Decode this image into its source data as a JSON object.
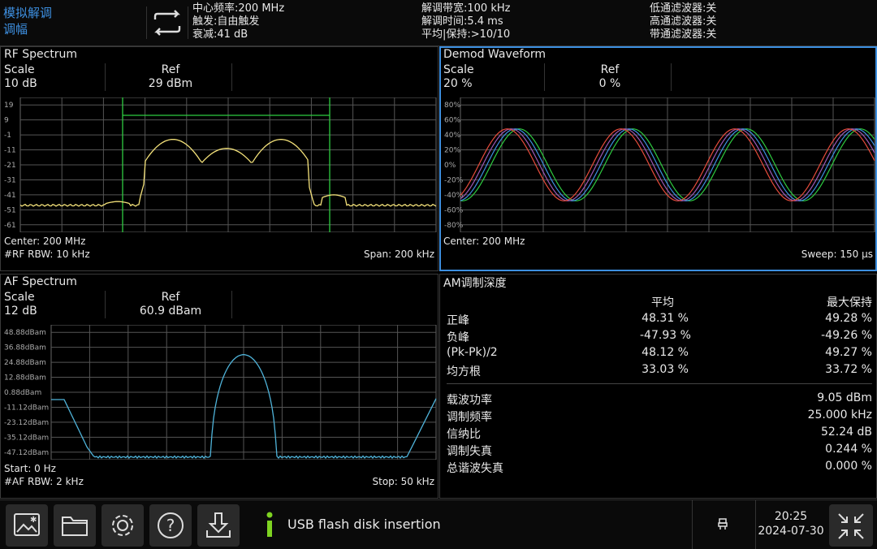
{
  "topbar": {
    "mode_line1": "模拟解调",
    "mode_line2": "调幅",
    "col1": [
      "中心频率:200 MHz",
      "触发:自由触发",
      "衰减:41 dB"
    ],
    "col2": [
      "解调带宽:100 kHz",
      "解调时间:5.4 ms",
      "平均|保持:>10/10"
    ],
    "col3": [
      "低通滤波器:关",
      "高通滤波器:关",
      "带通滤波器:关"
    ]
  },
  "rf": {
    "title": "RF Spectrum",
    "scale_label": "Scale",
    "scale_value": "10 dB",
    "ref_label": "Ref",
    "ref_value": "29 dBm",
    "yticks": [
      "19",
      "9",
      "-1",
      "-11",
      "-21",
      "-31",
      "-41",
      "-51",
      "-61"
    ],
    "center": "Center: 200 MHz",
    "rbw": "#RF RBW: 10 kHz",
    "span": "Span: 200 kHz",
    "trace_color": "#f4e27a",
    "marker_color": "#2ecc40"
  },
  "demod": {
    "title": "Demod Waveform",
    "scale_label": "Scale",
    "scale_value": "20 %",
    "ref_label": "Ref",
    "ref_value": "0 %",
    "yticks": [
      "80%",
      "60%",
      "40%",
      "20%",
      "0%",
      "-20%",
      "-40%",
      "-60%",
      "-80%"
    ],
    "center": "Center: 200 MHz",
    "sweep": "Sweep: 150 μs",
    "trace_colors": [
      "#2ecc40",
      "#3d8fe0",
      "#9b59b6",
      "#e74c3c"
    ]
  },
  "af": {
    "title": "AF Spectrum",
    "scale_label": "Scale",
    "scale_value": "12 dB",
    "ref_label": "Ref",
    "ref_value": "60.9 dBam",
    "yticks": [
      "48.88dBam",
      "36.88dBam",
      "24.88dBam",
      "12.88dBam",
      "0.88dBam",
      "-11.12dBam",
      "-23.12dBam",
      "-35.12dBam",
      "-47.12dBam"
    ],
    "start": "Start: 0 Hz",
    "rbw": "#AF RBW: 2 kHz",
    "stop": "Stop: 50 kHz",
    "trace_color": "#4fb3d9"
  },
  "am": {
    "title": "AM调制深度",
    "col_avg": "平均",
    "col_max": "最大保持",
    "rows": [
      {
        "label": "正峰",
        "avg": "48.31 %",
        "max": "49.28 %"
      },
      {
        "label": "负峰",
        "avg": "-47.93 %",
        "max": "-49.26 %"
      },
      {
        "label": "(Pk-Pk)/2",
        "avg": "48.12 %",
        "max": "49.27 %"
      },
      {
        "label": "均方根",
        "avg": "33.03 %",
        "max": "33.72 %"
      }
    ],
    "stats": [
      {
        "label": "载波功率",
        "value": "9.05 dBm"
      },
      {
        "label": "调制频率",
        "value": "25.000 kHz"
      },
      {
        "label": "信纳比",
        "value": "52.24 dB"
      },
      {
        "label": "调制失真",
        "value": "0.244 %"
      },
      {
        "label": "总谐波失真",
        "value": "0.000 %"
      }
    ]
  },
  "bottombar": {
    "message": "USB flash disk insertion",
    "time": "20:25",
    "date": "2024-07-30",
    "icons": [
      "screenshot-icon",
      "folder-icon",
      "gear-icon",
      "help-icon",
      "download-icon",
      "info-icon",
      "usb-icon",
      "collapse-icon"
    ]
  }
}
